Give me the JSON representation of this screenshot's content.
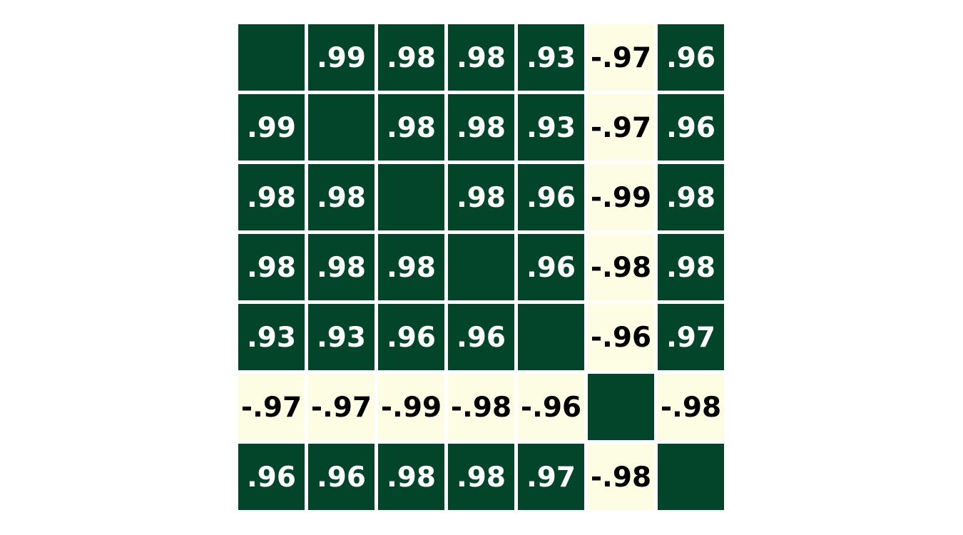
{
  "chart_data": {
    "type": "heatmap",
    "title": "",
    "xlabel": "",
    "ylabel": "",
    "size": 7,
    "values": [
      [
        null,
        0.99,
        0.98,
        0.98,
        0.93,
        -0.97,
        0.96
      ],
      [
        0.99,
        null,
        0.98,
        0.98,
        0.93,
        -0.97,
        0.96
      ],
      [
        0.98,
        0.98,
        null,
        0.98,
        0.96,
        -0.99,
        0.98
      ],
      [
        0.98,
        0.98,
        0.98,
        null,
        0.96,
        -0.98,
        0.98
      ],
      [
        0.93,
        0.93,
        0.96,
        0.96,
        null,
        -0.96,
        0.97
      ],
      [
        -0.97,
        -0.97,
        -0.99,
        -0.98,
        -0.96,
        null,
        -0.98
      ],
      [
        0.96,
        0.96,
        0.98,
        0.98,
        0.97,
        -0.98,
        null
      ]
    ],
    "labels": [
      [
        "",
        ".99",
        ".98",
        ".98",
        ".93",
        "-.97",
        ".96"
      ],
      [
        ".99",
        "",
        ".98",
        ".98",
        ".93",
        "-.97",
        ".96"
      ],
      [
        ".98",
        ".98",
        "",
        ".98",
        ".96",
        "-.99",
        ".98"
      ],
      [
        ".98",
        ".98",
        ".98",
        "",
        ".96",
        "-.98",
        ".98"
      ],
      [
        ".93",
        ".93",
        ".96",
        ".96",
        "",
        "-.96",
        ".97"
      ],
      [
        "-.97",
        "-.97",
        "-.99",
        "-.98",
        "-.96",
        "",
        "-.98"
      ],
      [
        ".96",
        ".96",
        ".98",
        ".98",
        ".97",
        "-.98",
        ""
      ]
    ],
    "diagonal_color": "#03452a",
    "colorscale": {
      "positive": "#03452a",
      "negative": "#fdfde4"
    },
    "text_colors": {
      "on_positive": "#ffffff",
      "on_negative": "#000000"
    },
    "legend": "none",
    "grid": false
  }
}
